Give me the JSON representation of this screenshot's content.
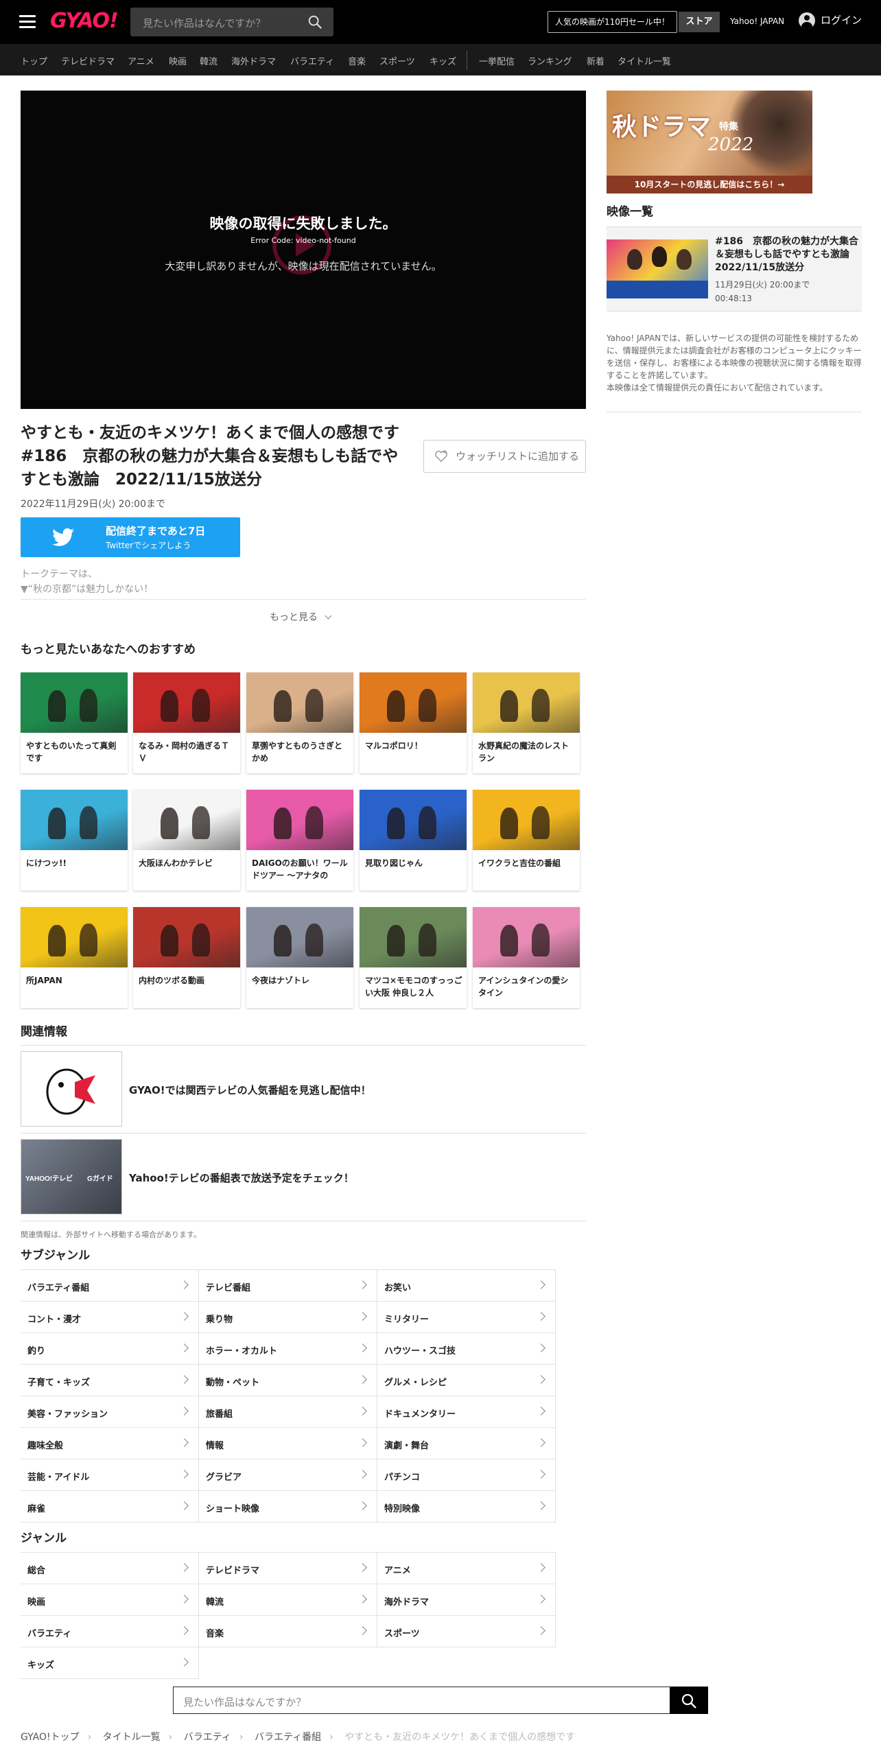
{
  "header": {
    "logo": "GYAO!",
    "search_placeholder": "見たい作品はなんですか？",
    "sale_label": "人気の映画が110円セール中！",
    "store_label": "ストア",
    "yahoo_label": "Yahoo! JAPAN",
    "login_label": "ログイン"
  },
  "catnav": [
    "トップ",
    "テレビドラマ",
    "アニメ",
    "映画",
    "韓流",
    "海外ドラマ",
    "バラエティ",
    "音楽",
    "スポーツ",
    "キッズ",
    "一挙配信",
    "ランキング",
    "新着",
    "タイトル一覧"
  ],
  "player": {
    "error_title": "映像の取得に失敗しました。",
    "error_code": "Error Code: video-not-found",
    "error_message": "大変申し訳ありませんが、映像は現在配信されていません。"
  },
  "program": {
    "title": "やすとも・友近のキメツケ！あくまで個人の感想です　#186　京都の秋の魅力が大集合＆妄想もしも話でやすとも激論　2022/11/15放送分",
    "watchlist_label": "ウォッチリストに追加する",
    "available_until": "2022年11月29日(火) 20:00まで",
    "twitter_line1": "配信終了まであと7日",
    "twitter_line2": "Twitterでシェアしよう",
    "description_line1": "トークテーマは、",
    "description_line2": "▼“秋の京都”は魅力しかない！",
    "more_label": "もっと見る"
  },
  "reco": {
    "heading": "もっと見たいあなたへのおすすめ",
    "items": [
      {
        "title": "やすとものいたって真剣です",
        "color": "#1f8a4c"
      },
      {
        "title": "なるみ・岡村の過ぎるＴＶ",
        "color": "#c92a2a"
      },
      {
        "title": "草彅やすとものうさぎとかめ",
        "color": "#d9b08a"
      },
      {
        "title": "マルコポロリ！",
        "color": "#e07a1f"
      },
      {
        "title": "水野真紀の魔法のレストラン",
        "color": "#e8c24a"
      },
      {
        "title": "にけつッ!!",
        "color": "#3bb0d9"
      },
      {
        "title": "大阪ほんわかテレビ",
        "color": "#f5f5f5"
      },
      {
        "title": "DAIGOのお願い！ワールドツアー 〜アナタの",
        "color": "#e65aa8"
      },
      {
        "title": "見取り図じゃん",
        "color": "#2a62c9"
      },
      {
        "title": "イワクラと吉住の番組",
        "color": "#f2b51d"
      },
      {
        "title": "所JAPAN",
        "color": "#f2c418"
      },
      {
        "title": "内村のツボる動画",
        "color": "#b8352c"
      },
      {
        "title": "今夜はナゾトレ",
        "color": "#8a8fa0"
      },
      {
        "title": "マツコ×モモコのすっっごい大阪 仲良し２人",
        "color": "#6a8a5a"
      },
      {
        "title": "アインシュタインの愛シタイン",
        "color": "#e98bb5"
      }
    ]
  },
  "related": {
    "heading": "関連情報",
    "items": [
      {
        "text": "GYAO!では関西テレビの人気番組を見逃し配信中！"
      },
      {
        "text": "Yahoo!テレビの番組表で放送予定をチェック！",
        "logo_text": "YAHOO!テレビ",
        "logo_text2": "Gガイド"
      }
    ],
    "note": "関連情報は、外部サイトへ移動する場合があります。"
  },
  "subgenre": {
    "heading": "サブジャンル",
    "items": [
      "バラエティ番組",
      "テレビ番組",
      "お笑い",
      "コント・漫才",
      "乗り物",
      "ミリタリー",
      "釣り",
      "ホラー・オカルト",
      "ハウツー・スゴ技",
      "子育て・キッズ",
      "動物・ペット",
      "グルメ・レシピ",
      "美容・ファッション",
      "旅番組",
      "ドキュメンタリー",
      "趣味全般",
      "情報",
      "演劇・舞台",
      "芸能・アイドル",
      "グラビア",
      "パチンコ",
      "麻雀",
      "ショート映像",
      "特別映像"
    ]
  },
  "genre": {
    "heading": "ジャンル",
    "items": [
      "総合",
      "テレビドラマ",
      "アニメ",
      "映画",
      "韓流",
      "海外ドラマ",
      "バラエティ",
      "音楽",
      "スポーツ",
      "キッズ"
    ]
  },
  "bottom_search": {
    "placeholder": "見たい作品はなんですか？"
  },
  "breadcrumb": [
    "GYAO!トップ",
    "タイトル一覧",
    "バラエティ",
    "バラエティ番組",
    "やすとも・友近のキメツケ！あくまで個人の感想です"
  ],
  "sidebar": {
    "banner_title": "秋ドラマ",
    "banner_sub": "特集",
    "banner_year": "2022",
    "banner_cta": "10月スタートの見逃し配信はこちら！→",
    "video_list_heading": "映像一覧",
    "video_item": {
      "title": "#186　京都の秋の魅力が大集合＆妄想もしも話でやすとも激論　2022/11/15放送分",
      "date": "11月29日(火) 20:00まで",
      "duration": "00:48:13"
    },
    "note": "Yahoo! JAPANでは、新しいサービスの提供の可能性を検討するために、情報提供元または調査会社がお客様のコンピュータ上にクッキーを送信・保存し、お客様による本映像の視聴状況に関する情報を取得することを許諾しています。\n本映像は全て情報提供元の責任において配信されています。"
  },
  "colors": {
    "brand": "#ff1a5e",
    "twitter": "#1da1f2"
  }
}
